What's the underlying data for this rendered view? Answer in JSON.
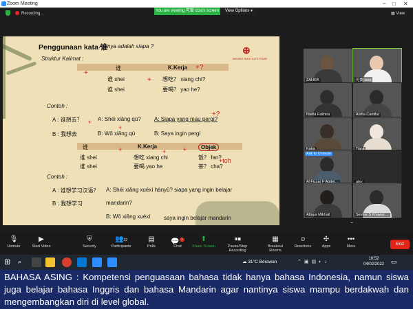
{
  "window": {
    "title": "Zoom Meeting",
    "controls": [
      "–",
      "□",
      "✕"
    ]
  },
  "share": {
    "banner": "You are viewing 可爱 izza's screen",
    "view_options": "View Options ▾"
  },
  "recording": {
    "label": "Recording..."
  },
  "view": {
    "label": "View"
  },
  "slide": {
    "title": "Penggunaan kata 谁",
    "meaning": "Artinya adalah siapa ?",
    "structure": "Struktur Kalimat :",
    "logo_text": "BEIJING INSTITUTE FOUR",
    "table1": {
      "head": [
        "谁",
        "K.Kerja"
      ],
      "rows": [
        [
          "谁 shei",
          "想吃？ xiang chi?"
        ],
        [
          "谁 shei",
          "要喝？ yao he?"
        ]
      ]
    },
    "contoh1": "Contoh :",
    "ex1": {
      "a": "A : 谁想去？",
      "b": "A: Shéi xiǎng qù?",
      "c": "A: Siapa yang mau pergi?"
    },
    "ex2": {
      "a": "B : 我想去",
      "b": "B: Wǒ xiǎng qù",
      "c": "B: Saya ingin pergi"
    },
    "table2": {
      "head": [
        "谁",
        "K.Kerja",
        "Objek"
      ],
      "rows": [
        [
          "谁 shei",
          "想吃 xiang chi",
          "饭？ fan?"
        ],
        [
          "谁 shei",
          "要喝 yao he",
          "茶？ cha?"
        ]
      ]
    },
    "contoh2": "Contoh :",
    "ex3": {
      "a": "A : 谁想学习汉语？",
      "b": "A: Shéi xiǎng xuéxí hànyǔ? siapa yang ingin belajar",
      "c": "mandarin?"
    },
    "ex4": {
      "a": "B : 我想学习",
      "b": "mandarin?"
    },
    "ex5": {
      "a": "B: Wǒ xiǎng xuéxí",
      "b": "saya ingin belajar mandarin"
    },
    "annotations": [
      "+?",
      "+",
      "+",
      "+?",
      "+",
      "+",
      "+",
      "+",
      "+",
      "+toh"
    ]
  },
  "participants": [
    {
      "name": "ZAHRA",
      "bg": "#a89272"
    },
    {
      "name": "可爱 izza",
      "bg": "#e5d6c4"
    },
    {
      "name": "Nadia Fakhira",
      "bg": "#8a7d72"
    },
    {
      "name": "Aisha Cantika",
      "bg": "#9d8875"
    },
    {
      "name": "Kaka",
      "bg": "#b4a08a"
    },
    {
      "name": "Tiara",
      "bg": "#ccb7a3"
    },
    {
      "name": "Al Fizzar F Abdel…",
      "bg": "#6a7d8e"
    },
    {
      "name": "aisy",
      "bg": "#2b2b2b"
    },
    {
      "name": "Attaya Mikhail",
      "bg": "#8f8270"
    },
    {
      "name": "Sevine S Khawar…",
      "bg": "#9a9a9a"
    }
  ],
  "ask_to_unmute": "Ask to Unmute",
  "toolbar": {
    "unmute": "Unmute",
    "start_video": "Start Video",
    "security": "Security",
    "participants": "Participants",
    "participants_count": "22",
    "polls": "Polls",
    "chat": "Chat",
    "chat_badge": "1",
    "share_screen": "Share Screen",
    "pause_recording": "Pause/Stop Recording",
    "breakout": "Breakout Rooms",
    "reactions": "Reactions",
    "apps": "Apps",
    "more": "More",
    "end": "End"
  },
  "taskbar": {
    "weather": "31°C Berawan",
    "time": "10:52",
    "date": "04/02/2022",
    "search_icon": "search-icon"
  },
  "caption": {
    "bold": "BAHASA ASING",
    "text": " : Kompetensi penguasaan bahasa tidak hanya bahasa Indonesia, namun siswa juga belajar bahasa Inggris dan bahasa Mandarin agar nantinya siswa mampu berdakwah dan mengembangkan diri di level global."
  },
  "colors": {
    "caption_bg": "#1a2a66",
    "share_green": "#2ab144",
    "end_red": "#e0261b",
    "slide_bg": "#efe0b8",
    "annotation_red": "#c0201b"
  }
}
